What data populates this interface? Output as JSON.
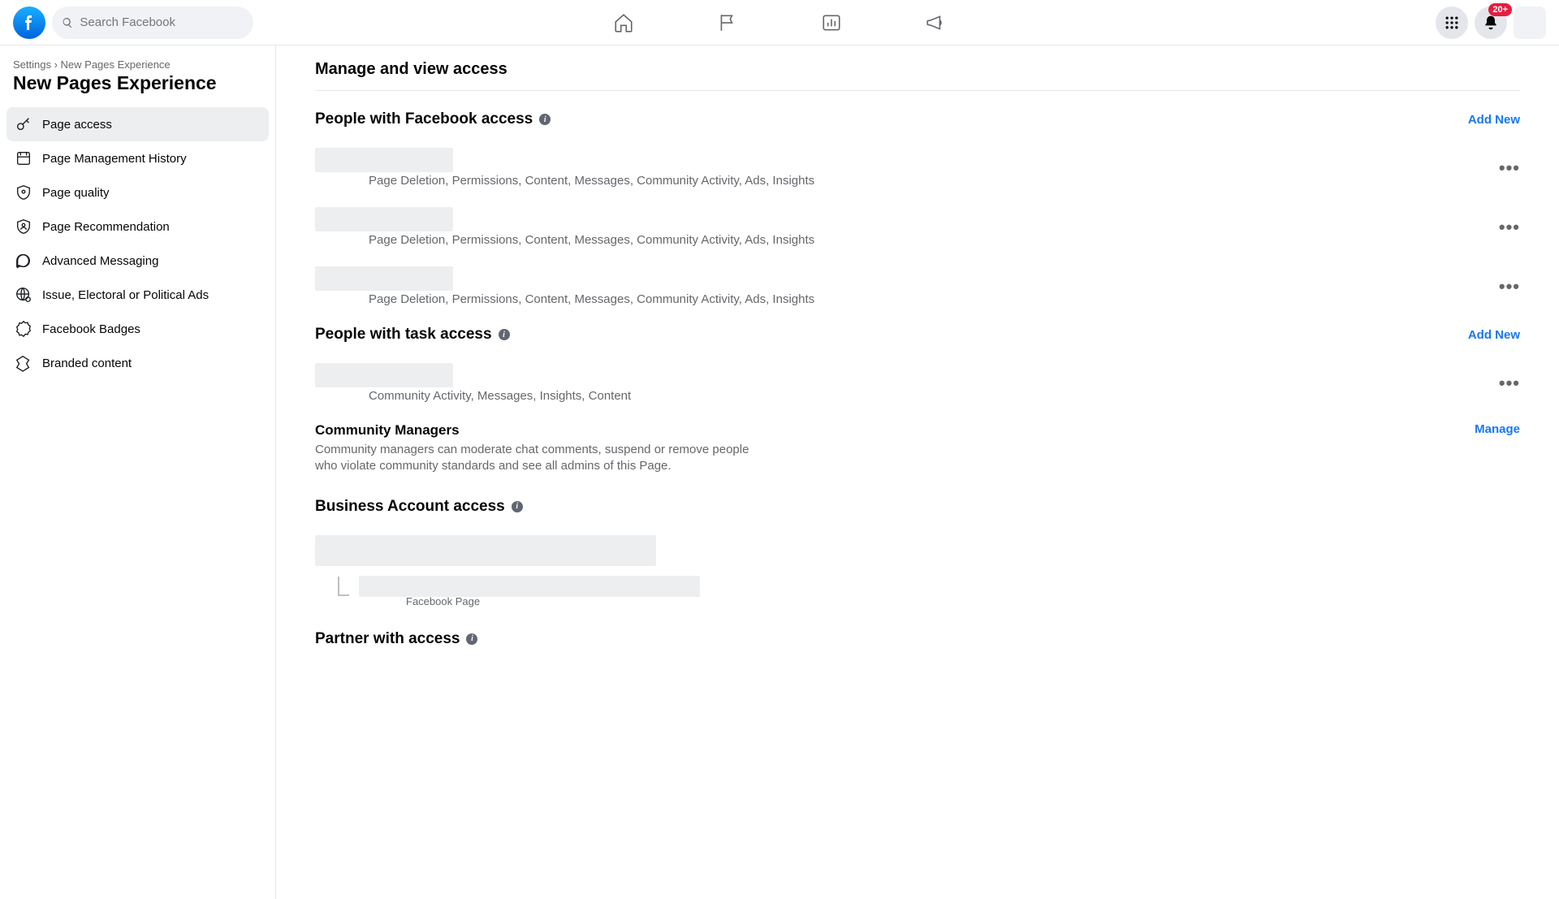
{
  "search": {
    "placeholder": "Search Facebook"
  },
  "notifications_badge": "20+",
  "breadcrumb": "Settings › New Pages Experience",
  "page_title": "New Pages Experience",
  "sidebar": {
    "items": [
      {
        "label": "Page access"
      },
      {
        "label": "Page Management History"
      },
      {
        "label": "Page quality"
      },
      {
        "label": "Page Recommendation"
      },
      {
        "label": "Advanced Messaging"
      },
      {
        "label": "Issue, Electoral or Political Ads"
      },
      {
        "label": "Facebook Badges"
      },
      {
        "label": "Branded content"
      }
    ]
  },
  "main": {
    "title": "Manage and view access",
    "facebook_access": {
      "title": "People with Facebook access",
      "add_new": "Add New",
      "people": [
        {
          "permissions": "Page Deletion, Permissions, Content, Messages, Community Activity, Ads, Insights"
        },
        {
          "permissions": "Page Deletion, Permissions, Content, Messages, Community Activity, Ads, Insights"
        },
        {
          "permissions": "Page Deletion, Permissions, Content, Messages, Community Activity, Ads, Insights"
        }
      ]
    },
    "task_access": {
      "title": "People with task access",
      "add_new": "Add New",
      "people": [
        {
          "permissions": "Community Activity, Messages, Insights, Content"
        }
      ]
    },
    "community_managers": {
      "title": "Community Managers",
      "desc": "Community managers can moderate chat comments, suspend or remove people who violate community standards and see all admins of this Page.",
      "manage": "Manage"
    },
    "business_access": {
      "title": "Business Account access",
      "page_label": "Facebook Page"
    },
    "partner_access": {
      "title": "Partner with access"
    }
  }
}
